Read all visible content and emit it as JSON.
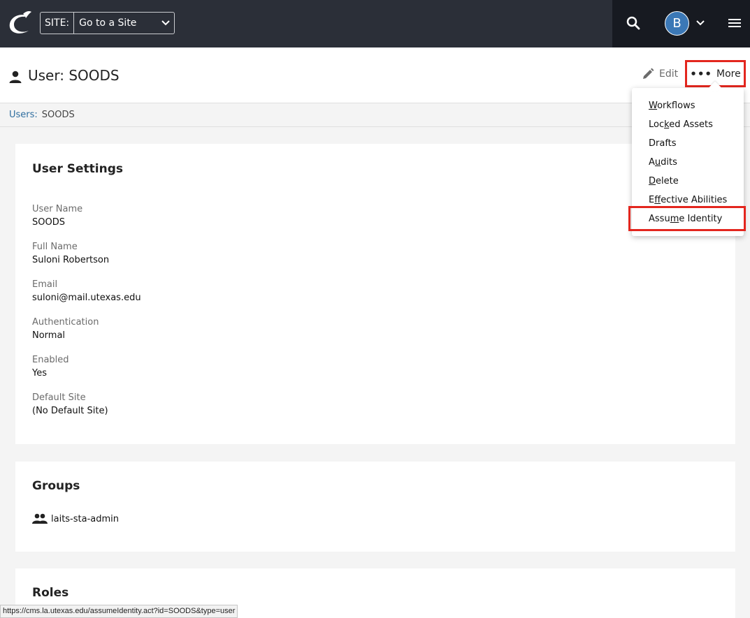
{
  "topbar": {
    "site_label": "SITE:",
    "site_value": "Go to a Site",
    "avatar_initial": "B"
  },
  "header": {
    "title": "User: SOODS",
    "edit_label": "Edit",
    "more_label": "More"
  },
  "breadcrumb": {
    "link": "Users:",
    "current": "SOODS"
  },
  "user_settings": {
    "title": "User Settings",
    "fields": [
      {
        "label": "User Name",
        "value": "SOODS"
      },
      {
        "label": "Full Name",
        "value": "Suloni Robertson"
      },
      {
        "label": "Email",
        "value": "suloni@mail.utexas.edu"
      },
      {
        "label": "Authentication",
        "value": "Normal"
      },
      {
        "label": "Enabled",
        "value": "Yes"
      },
      {
        "label": "Default Site",
        "value": "(No Default Site)"
      }
    ]
  },
  "groups": {
    "title": "Groups",
    "items": [
      "laits-sta-admin"
    ]
  },
  "roles": {
    "title": "Roles"
  },
  "more_menu": {
    "items": [
      {
        "label": "Workflows",
        "accel_before": "",
        "accel": "W",
        "accel_after": "orkflows"
      },
      {
        "label": "Locked Assets",
        "accel_before": "Loc",
        "accel": "k",
        "accel_after": "ed Assets"
      },
      {
        "label": "Drafts",
        "accel_before": "",
        "accel": "",
        "accel_after": "Drafts"
      },
      {
        "label": "Audits",
        "accel_before": "A",
        "accel": "u",
        "accel_after": "dits"
      },
      {
        "label": "Delete",
        "accel_before": "",
        "accel": "D",
        "accel_after": "elete"
      },
      {
        "label": "Effective Abilities",
        "accel_before": "E",
        "accel": "f",
        "accel_after": "fective Abilities"
      },
      {
        "label": "Assume Identity",
        "accel_before": "Assu",
        "accel": "m",
        "accel_after": "e Identity"
      }
    ]
  },
  "status_bar": {
    "url": "https://cms.la.utexas.edu/assumeIdentity.act?id=SOODS&type=user"
  },
  "colors": {
    "topbar": "#2b2f38",
    "topbar_right": "#171a21",
    "highlight": "#e3261e",
    "link": "#2f6e9f",
    "avatar": "#3b78b6"
  }
}
